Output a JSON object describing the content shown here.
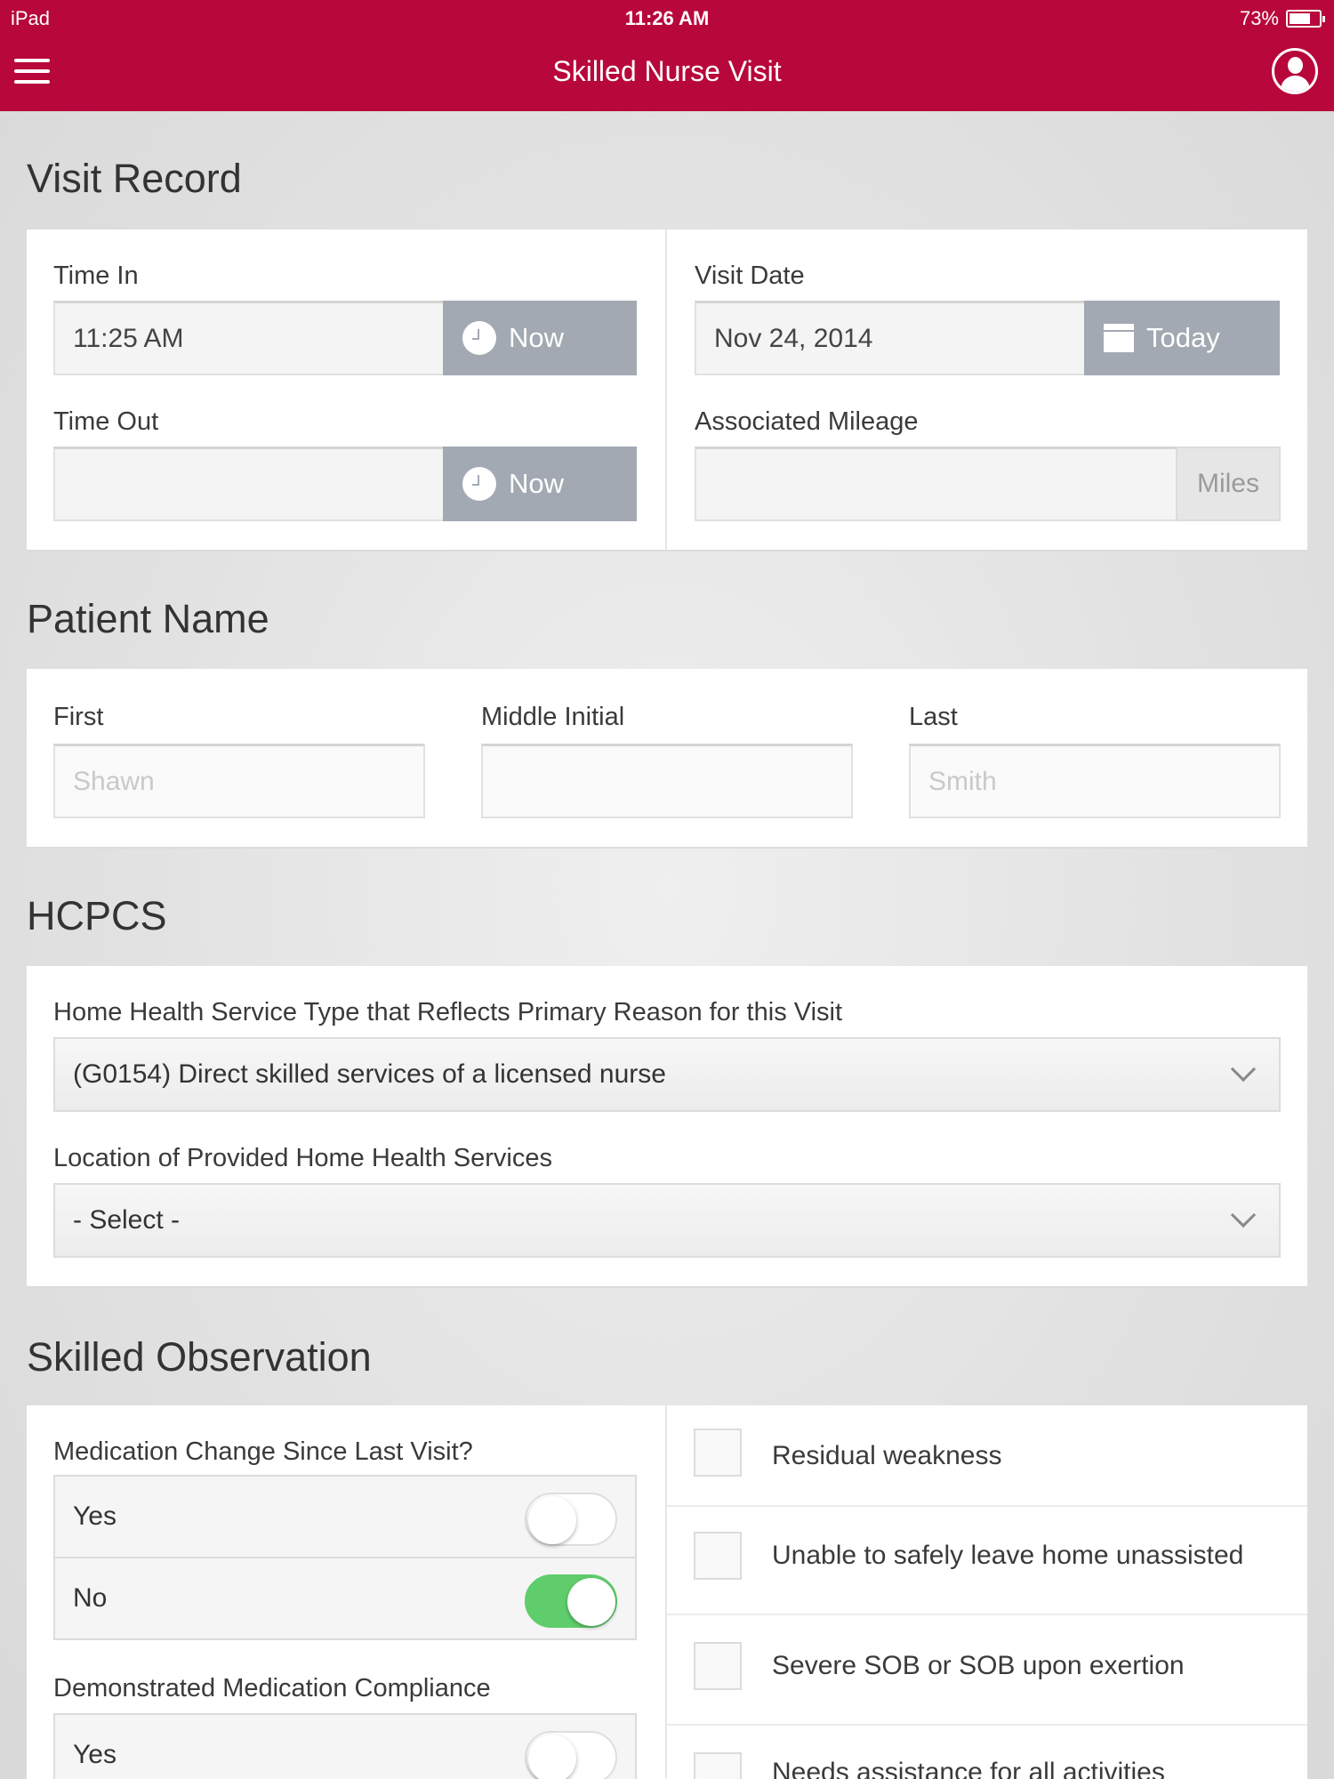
{
  "status_bar": {
    "carrier": "iPad",
    "time": "11:26 AM",
    "battery": "73%",
    "battery_level": 0.73
  },
  "nav": {
    "title": "Skilled Nurse Visit",
    "menu_icon": "hamburger-icon",
    "profile_icon": "user-avatar-icon"
  },
  "visit_record": {
    "title": "Visit Record",
    "time_in_label": "Time In",
    "time_in_value": "11:25 AM",
    "time_out_label": "Time Out",
    "time_out_value": "",
    "now_label": "Now",
    "visit_date_label": "Visit Date",
    "visit_date_value": "Nov 24, 2014",
    "today_label": "Today",
    "mileage_label": "Associated Mileage",
    "mileage_value": "",
    "miles_unit": "Miles"
  },
  "patient_name": {
    "title": "Patient Name",
    "first_label": "First",
    "first_value": "Shawn",
    "middle_label": "Middle Initial",
    "middle_value": "",
    "last_label": "Last",
    "last_value": "Smith"
  },
  "hcpcs": {
    "title": "HCPCS",
    "service_type_label": "Home Health Service Type that Reflects Primary Reason for this Visit",
    "service_type_value": "(G0154) Direct skilled services of a licensed nurse",
    "location_label": "Location of Provided Home Health Services",
    "location_value": "- Select -"
  },
  "skilled_observation": {
    "title": "Skilled Observation",
    "med_change_label": "Medication Change Since Last Visit?",
    "yes_label": "Yes",
    "no_label": "No",
    "med_change_yes_on": false,
    "med_change_no_on": true,
    "compliance_label": "Demonstrated Medication Compliance",
    "compliance_yes_on": false,
    "checks": [
      {
        "label": "Residual weakness",
        "checked": false
      },
      {
        "label": "Unable to safely leave home unassisted",
        "checked": false
      },
      {
        "label": "Severe SOB or SOB upon exertion",
        "checked": false
      },
      {
        "label": "Needs assistance for all activities",
        "checked": false
      }
    ]
  },
  "colors": {
    "brand": "#b8073a",
    "button_grey": "#a2a9b2",
    "toggle_on": "#5fcd6b"
  }
}
